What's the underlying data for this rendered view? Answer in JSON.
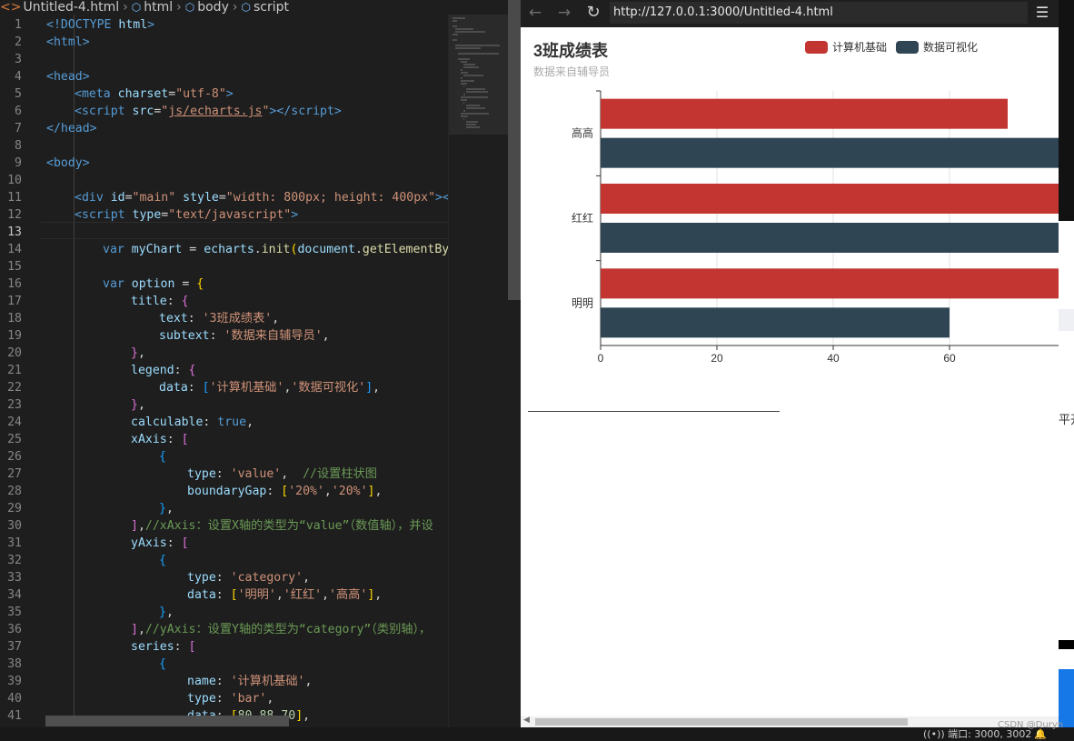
{
  "editor": {
    "breadcrumb": [
      "Untitled-4.html",
      "html",
      "body",
      "script"
    ],
    "active_line": 13,
    "lines": [
      {
        "n": "1",
        "i": 0,
        "t": [
          [
            "<!DOCTYPE",
            "c-tag"
          ],
          [
            " html",
            "c-attr"
          ],
          [
            ">",
            "c-tag"
          ]
        ]
      },
      {
        "n": "2",
        "i": 0,
        "t": [
          [
            "<html>",
            "c-tag"
          ]
        ]
      },
      {
        "n": "3",
        "i": 0,
        "t": []
      },
      {
        "n": "4",
        "i": 0,
        "t": [
          [
            "<head>",
            "c-tag"
          ]
        ]
      },
      {
        "n": "5",
        "i": 1,
        "t": [
          [
            "<meta",
            "c-tag"
          ],
          [
            " charset",
            "c-attr"
          ],
          [
            "=",
            ""
          ],
          [
            "\"utf-8\"",
            "c-str"
          ],
          [
            ">",
            "c-tag"
          ]
        ]
      },
      {
        "n": "6",
        "i": 1,
        "t": [
          [
            "<script",
            "c-tag"
          ],
          [
            " src",
            "c-attr"
          ],
          [
            "=",
            ""
          ],
          [
            "\"",
            "c-str"
          ],
          [
            "js/echarts.js",
            "c-str c-u"
          ],
          [
            "\"",
            "c-str"
          ],
          [
            "></",
            "c-tag"
          ],
          [
            "script",
            "c-tag"
          ],
          [
            ">",
            "c-tag"
          ]
        ]
      },
      {
        "n": "7",
        "i": 0,
        "t": [
          [
            "</head>",
            "c-tag"
          ]
        ]
      },
      {
        "n": "8",
        "i": 0,
        "t": []
      },
      {
        "n": "9",
        "i": 0,
        "t": [
          [
            "<body>",
            "c-tag"
          ]
        ]
      },
      {
        "n": "10",
        "i": 0,
        "t": []
      },
      {
        "n": "11",
        "i": 1,
        "t": [
          [
            "<div",
            "c-tag"
          ],
          [
            " id",
            "c-attr"
          ],
          [
            "=",
            ""
          ],
          [
            "\"main\"",
            "c-str"
          ],
          [
            " style",
            "c-attr"
          ],
          [
            "=",
            ""
          ],
          [
            "\"width: 800px; height: 400px\"",
            "c-str"
          ],
          [
            "></d",
            "c-tag"
          ]
        ]
      },
      {
        "n": "12",
        "i": 1,
        "t": [
          [
            "<script",
            "c-tag"
          ],
          [
            " type",
            "c-attr"
          ],
          [
            "=",
            ""
          ],
          [
            "\"text/javascript\"",
            "c-str"
          ],
          [
            ">",
            "c-tag"
          ]
        ]
      },
      {
        "n": "13",
        "i": 0,
        "t": []
      },
      {
        "n": "14",
        "i": 2,
        "t": [
          [
            "var",
            "c-kw"
          ],
          [
            " ",
            ""
          ],
          [
            "myChart",
            "c-var"
          ],
          [
            " = ",
            ""
          ],
          [
            "echarts",
            "c-var"
          ],
          [
            ".",
            ""
          ],
          [
            "init",
            "c-fn"
          ],
          [
            "(",
            "c-b1"
          ],
          [
            "document",
            "c-var"
          ],
          [
            ".",
            ""
          ],
          [
            "getElementById",
            "c-fn"
          ]
        ]
      },
      {
        "n": "15",
        "i": 0,
        "t": []
      },
      {
        "n": "16",
        "i": 2,
        "t": [
          [
            "var",
            "c-kw"
          ],
          [
            " ",
            ""
          ],
          [
            "option",
            "c-var"
          ],
          [
            " = ",
            ""
          ],
          [
            "{",
            "c-b1"
          ]
        ]
      },
      {
        "n": "17",
        "i": 3,
        "t": [
          [
            "title",
            "c-var"
          ],
          [
            ": ",
            ""
          ],
          [
            "{",
            "c-b2"
          ]
        ]
      },
      {
        "n": "18",
        "i": 4,
        "t": [
          [
            "text",
            "c-var"
          ],
          [
            ": ",
            ""
          ],
          [
            "'3班成绩表'",
            "c-str"
          ],
          [
            ",",
            ""
          ]
        ]
      },
      {
        "n": "19",
        "i": 4,
        "t": [
          [
            "subtext",
            "c-var"
          ],
          [
            ": ",
            ""
          ],
          [
            "'数据来自辅导员'",
            "c-str"
          ],
          [
            ",",
            ""
          ]
        ]
      },
      {
        "n": "20",
        "i": 3,
        "t": [
          [
            "}",
            "c-b2"
          ],
          [
            ",",
            ""
          ]
        ]
      },
      {
        "n": "21",
        "i": 3,
        "t": [
          [
            "legend",
            "c-var"
          ],
          [
            ": ",
            ""
          ],
          [
            "{",
            "c-b2"
          ]
        ]
      },
      {
        "n": "22",
        "i": 4,
        "t": [
          [
            "data",
            "c-var"
          ],
          [
            ": ",
            ""
          ],
          [
            "[",
            "c-b3"
          ],
          [
            "'计算机基础'",
            "c-str"
          ],
          [
            ",",
            ""
          ],
          [
            "'数据可视化'",
            "c-str"
          ],
          [
            "]",
            "c-b3"
          ],
          [
            ",",
            ""
          ]
        ]
      },
      {
        "n": "23",
        "i": 3,
        "t": [
          [
            "}",
            "c-b2"
          ],
          [
            ",",
            ""
          ]
        ]
      },
      {
        "n": "24",
        "i": 3,
        "t": [
          [
            "calculable",
            "c-var"
          ],
          [
            ": ",
            ""
          ],
          [
            "true",
            "c-kw"
          ],
          [
            ",",
            ""
          ]
        ]
      },
      {
        "n": "25",
        "i": 3,
        "t": [
          [
            "xAxis",
            "c-var"
          ],
          [
            ": ",
            ""
          ],
          [
            "[",
            "c-b2"
          ]
        ]
      },
      {
        "n": "26",
        "i": 4,
        "t": [
          [
            "{",
            "c-b3"
          ]
        ]
      },
      {
        "n": "27",
        "i": 5,
        "t": [
          [
            "type",
            "c-var"
          ],
          [
            ": ",
            ""
          ],
          [
            "'value'",
            "c-str"
          ],
          [
            ",  ",
            ""
          ],
          [
            "//设置柱状图",
            "c-com"
          ]
        ]
      },
      {
        "n": "28",
        "i": 5,
        "t": [
          [
            "boundaryGap",
            "c-var"
          ],
          [
            ": ",
            ""
          ],
          [
            "[",
            "c-b1"
          ],
          [
            "'20%'",
            "c-str"
          ],
          [
            ",",
            ""
          ],
          [
            "'20%'",
            "c-str"
          ],
          [
            "]",
            "c-b1"
          ],
          [
            ",",
            ""
          ]
        ]
      },
      {
        "n": "29",
        "i": 4,
        "t": [
          [
            "}",
            "c-b3"
          ],
          [
            ",",
            ""
          ]
        ]
      },
      {
        "n": "30",
        "i": 3,
        "t": [
          [
            "]",
            "c-b2"
          ],
          [
            ",",
            ""
          ],
          [
            "//xAxis：设置X轴的类型为“value”（数值轴），并设",
            "c-com"
          ]
        ]
      },
      {
        "n": "31",
        "i": 3,
        "t": [
          [
            "yAxis",
            "c-var"
          ],
          [
            ": ",
            ""
          ],
          [
            "[",
            "c-b2"
          ]
        ]
      },
      {
        "n": "32",
        "i": 4,
        "t": [
          [
            "{",
            "c-b3"
          ]
        ]
      },
      {
        "n": "33",
        "i": 5,
        "t": [
          [
            "type",
            "c-var"
          ],
          [
            ": ",
            ""
          ],
          [
            "'category'",
            "c-str"
          ],
          [
            ",",
            ""
          ]
        ]
      },
      {
        "n": "34",
        "i": 5,
        "t": [
          [
            "data",
            "c-var"
          ],
          [
            ": ",
            ""
          ],
          [
            "[",
            "c-b1"
          ],
          [
            "'明明'",
            "c-str"
          ],
          [
            ",",
            ""
          ],
          [
            "'红红'",
            "c-str"
          ],
          [
            ",",
            ""
          ],
          [
            "'高高'",
            "c-str"
          ],
          [
            "]",
            "c-b1"
          ],
          [
            ",",
            ""
          ]
        ]
      },
      {
        "n": "35",
        "i": 4,
        "t": [
          [
            "}",
            "c-b3"
          ],
          [
            ",",
            ""
          ]
        ]
      },
      {
        "n": "36",
        "i": 3,
        "t": [
          [
            "]",
            "c-b2"
          ],
          [
            ",",
            ""
          ],
          [
            "//yAxis：设置Y轴的类型为“category”（类别轴），",
            "c-com"
          ]
        ]
      },
      {
        "n": "37",
        "i": 3,
        "t": [
          [
            "series",
            "c-var"
          ],
          [
            ": ",
            ""
          ],
          [
            "[",
            "c-b2"
          ]
        ]
      },
      {
        "n": "38",
        "i": 4,
        "t": [
          [
            "{",
            "c-b3"
          ]
        ]
      },
      {
        "n": "39",
        "i": 5,
        "t": [
          [
            "name",
            "c-var"
          ],
          [
            ": ",
            ""
          ],
          [
            "'计算机基础'",
            "c-str"
          ],
          [
            ",",
            ""
          ]
        ]
      },
      {
        "n": "40",
        "i": 5,
        "t": [
          [
            "type",
            "c-var"
          ],
          [
            ": ",
            ""
          ],
          [
            "'bar'",
            "c-str"
          ],
          [
            ",",
            ""
          ]
        ]
      },
      {
        "n": "41",
        "i": 5,
        "t": [
          [
            "data",
            "c-var"
          ],
          [
            ": ",
            ""
          ],
          [
            "[",
            "c-b1"
          ],
          [
            "80",
            "c-num"
          ],
          [
            ",",
            ""
          ],
          [
            "88",
            "c-num"
          ],
          [
            ",",
            ""
          ],
          [
            "70",
            "c-num"
          ],
          [
            "]",
            "c-b1"
          ],
          [
            ",",
            ""
          ]
        ]
      }
    ]
  },
  "browser": {
    "back_icon": "arrow-left-icon",
    "forward_icon": "arrow-right-icon",
    "refresh_icon": "refresh-icon",
    "menu_icon": "hamburger-menu-icon",
    "url": "http://127.0.0.1:3000/Untitled-4.html"
  },
  "chart_data": {
    "type": "bar",
    "orientation": "horizontal",
    "title": "3班成绩表",
    "subtitle": "数据来自辅导员",
    "legend": [
      "计算机基础",
      "数据可视化"
    ],
    "legend_position": "top-right",
    "categories": [
      "明明",
      "红红",
      "高高"
    ],
    "series": [
      {
        "name": "计算机基础",
        "color": "#c23531",
        "values": [
          80,
          88,
          70
        ]
      },
      {
        "name": "数据可视化",
        "color": "#2f4554",
        "values": [
          60,
          80,
          85
        ]
      }
    ],
    "x_ticks": [
      "0",
      "20",
      "40",
      "60"
    ],
    "xlim": [
      0,
      100
    ],
    "grid": "vertical"
  },
  "side_strip": {
    "text": "平开"
  },
  "statusbar": {
    "ports": "端口: 3000, 3002",
    "ports_icon": "broadcast-icon",
    "bell_icon": "bell-icon",
    "watermark": "CSDN @Duryn"
  }
}
